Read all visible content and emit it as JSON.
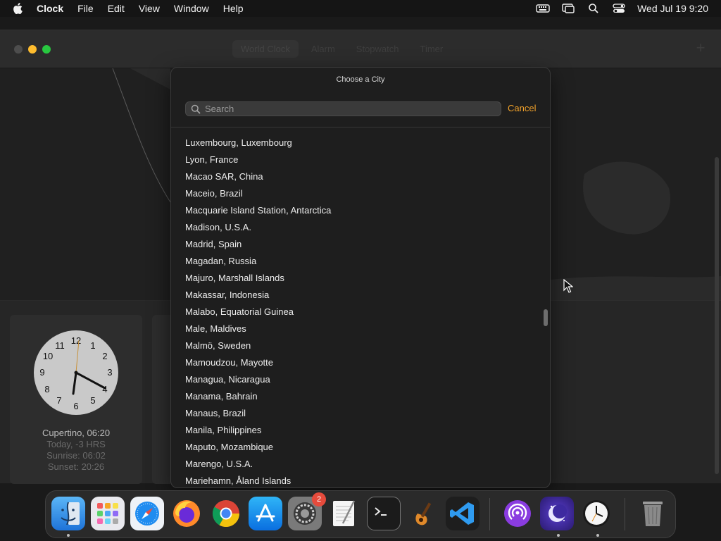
{
  "menubar": {
    "app_name": "Clock",
    "items": [
      "File",
      "Edit",
      "View",
      "Window",
      "Help"
    ],
    "datetime": "Wed Jul 19  9:20"
  },
  "window": {
    "tabs": [
      "World Clock",
      "Alarm",
      "Stopwatch",
      "Timer"
    ],
    "add_symbol": "+"
  },
  "world_clock": {
    "city": "Cupertino, 06:20",
    "day": "Today, -3 HRS",
    "sunrise": "Sunrise: 06:02",
    "sunset": "Sunset: 20:26",
    "clock_numerals": [
      "12",
      "1",
      "2",
      "3",
      "4",
      "5",
      "6",
      "7",
      "8",
      "9",
      "10",
      "11"
    ]
  },
  "sheet": {
    "title": "Choose a City",
    "search_placeholder": "Search",
    "cancel_label": "Cancel",
    "cities": [
      "Luxembourg, Luxembourg",
      "Lyon, France",
      "Macao SAR, China",
      "Maceio, Brazil",
      "Macquarie Island Station, Antarctica",
      "Madison, U.S.A.",
      "Madrid, Spain",
      "Magadan, Russia",
      "Majuro, Marshall Islands",
      "Makassar, Indonesia",
      "Malabo, Equatorial Guinea",
      "Male, Maldives",
      "Malmö, Sweden",
      "Mamoudzou, Mayotte",
      "Managua, Nicaragua",
      "Manama, Bahrain",
      "Manaus, Brazil",
      "Manila, Philippines",
      "Maputo, Mozambique",
      "Marengo, U.S.A.",
      "Mariehamn, Åland Islands"
    ]
  },
  "dock": {
    "settings_badge": "2",
    "apps": [
      "finder-icon",
      "launchpad-icon",
      "safari-icon",
      "firefox-icon",
      "chrome-icon",
      "app-store-icon",
      "system-settings-icon",
      "textedit-icon",
      "terminal-icon",
      "garageband-icon",
      "vscode-icon",
      "podcasts-icon",
      "nova-icon",
      "clock-icon",
      "trash-icon"
    ]
  },
  "colors": {
    "accent": "#f0a12a",
    "badge": "#e74b3c"
  }
}
